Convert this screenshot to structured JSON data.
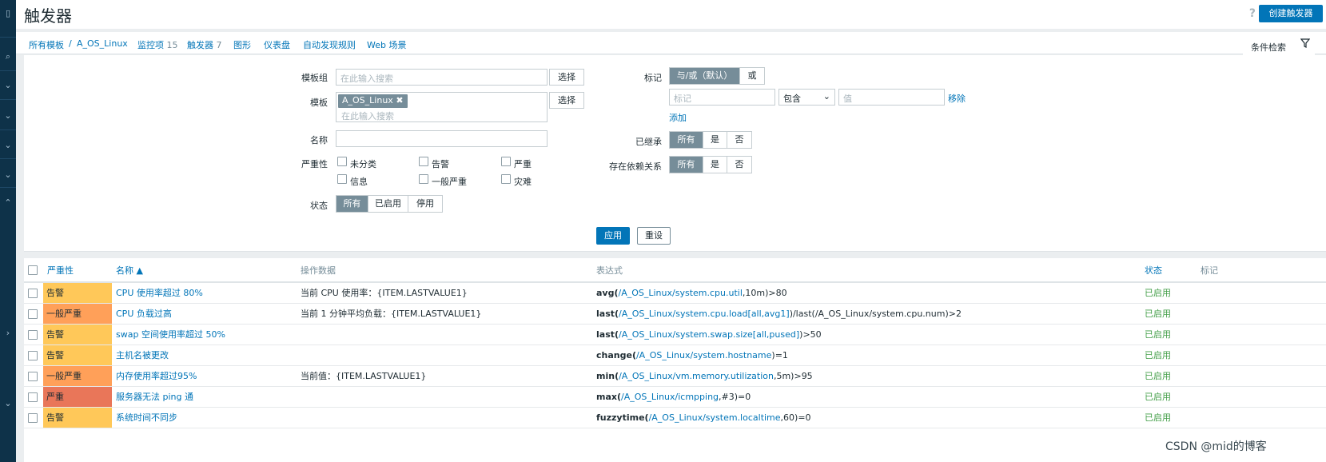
{
  "header": {
    "title": "触发器",
    "help_icon": "?",
    "create_button": "创建触发器"
  },
  "nav": {
    "all_templates": "所有模板",
    "separator": "/",
    "template": "A_OS_Linux",
    "items_label": "监控项",
    "items_count": "15",
    "triggers_label": "触发器",
    "triggers_count": "7",
    "graphs": "图形",
    "dashboards": "仪表盘",
    "discovery": "自动发现规则",
    "web": "Web 场景"
  },
  "filter_tab": {
    "label": "条件检索",
    "icon": "filter-icon"
  },
  "filter": {
    "template_group_label": "模板组",
    "template_group_placeholder": "在此输入搜索",
    "select_button": "选择",
    "template_label": "模板",
    "template_chip": "A_OS_Linux",
    "template_chip_remove": "✖",
    "template_placeholder": "在此输入搜索",
    "name_label": "名称",
    "severity_label": "严重性",
    "severities": [
      "未分类",
      "信息",
      "告警",
      "一般严重",
      "严重",
      "灾难"
    ],
    "state_label": "状态",
    "state_options": [
      "所有",
      "已启用",
      "停用"
    ],
    "tags_label": "标记",
    "tags_mode": [
      "与/或（默认）",
      "或"
    ],
    "tag_placeholder": "标记",
    "tag_operator": "包含",
    "tag_value_placeholder": "值",
    "remove_link": "移除",
    "add_link": "添加",
    "inherited_label": "已继承",
    "inherited_options": [
      "所有",
      "是",
      "否"
    ],
    "dependencies_label": "存在依赖关系",
    "dependencies_options": [
      "所有",
      "是",
      "否"
    ],
    "apply_button": "应用",
    "reset_button": "重设"
  },
  "table": {
    "headers": {
      "severity": "严重性",
      "name": "名称 ▲",
      "operational": "操作数据",
      "expression": "表达式",
      "status": "状态",
      "tags": "标记"
    },
    "rows": [
      {
        "severity": "告警",
        "sev_color": "#ffc859",
        "name": "CPU 使用率超过 80%",
        "opdata": "当前 CPU 使用率：{ITEM.LASTVALUE1}",
        "fn": "avg(",
        "host": "/A_OS_Linux/",
        "key": "system.cpu.util",
        "tail": ",10m)>80",
        "status": "已启用"
      },
      {
        "severity": "一般严重",
        "sev_color": "#ffa059",
        "name": "CPU 负载过高",
        "opdata": "当前 1 分钟平均负载：{ITEM.LASTVALUE1}",
        "fn": "last(",
        "host": "/A_OS_Linux/",
        "key": "system.cpu.load[all,avg1]",
        "tail": ")/last(/A_OS_Linux/system.cpu.num)>2",
        "status": "已启用"
      },
      {
        "severity": "告警",
        "sev_color": "#ffc859",
        "name": "swap 空间使用率超过 50%",
        "opdata": "",
        "fn": "last(",
        "host": "/A_OS_Linux/",
        "key": "system.swap.size[all,pused]",
        "tail": ")>50",
        "status": "已启用"
      },
      {
        "severity": "告警",
        "sev_color": "#ffc859",
        "name": "主机名被更改",
        "opdata": "",
        "fn": "change(",
        "host": "/A_OS_Linux/",
        "key": "system.hostname",
        "tail": ")=1",
        "status": "已启用"
      },
      {
        "severity": "一般严重",
        "sev_color": "#ffa059",
        "name": "内存使用率超过95%",
        "opdata": "当前值：{ITEM.LASTVALUE1}",
        "fn": "min(",
        "host": "/A_OS_Linux/",
        "key": "vm.memory.utilization",
        "tail": ",5m)>95",
        "status": "已启用"
      },
      {
        "severity": "严重",
        "sev_color": "#e97659",
        "name": "服务器无法 ping 通",
        "opdata": "",
        "fn": "max(",
        "host": "/A_OS_Linux/",
        "key": "icmpping",
        "tail": ",#3)=0",
        "status": "已启用"
      },
      {
        "severity": "告警",
        "sev_color": "#ffc859",
        "name": "系统时间不同步",
        "opdata": "",
        "fn": "fuzzytime(",
        "host": "/A_OS_Linux/",
        "key": "system.localtime",
        "tail": ",60)=0",
        "status": "已启用"
      }
    ]
  },
  "watermark": "CSDN @mid的博客"
}
